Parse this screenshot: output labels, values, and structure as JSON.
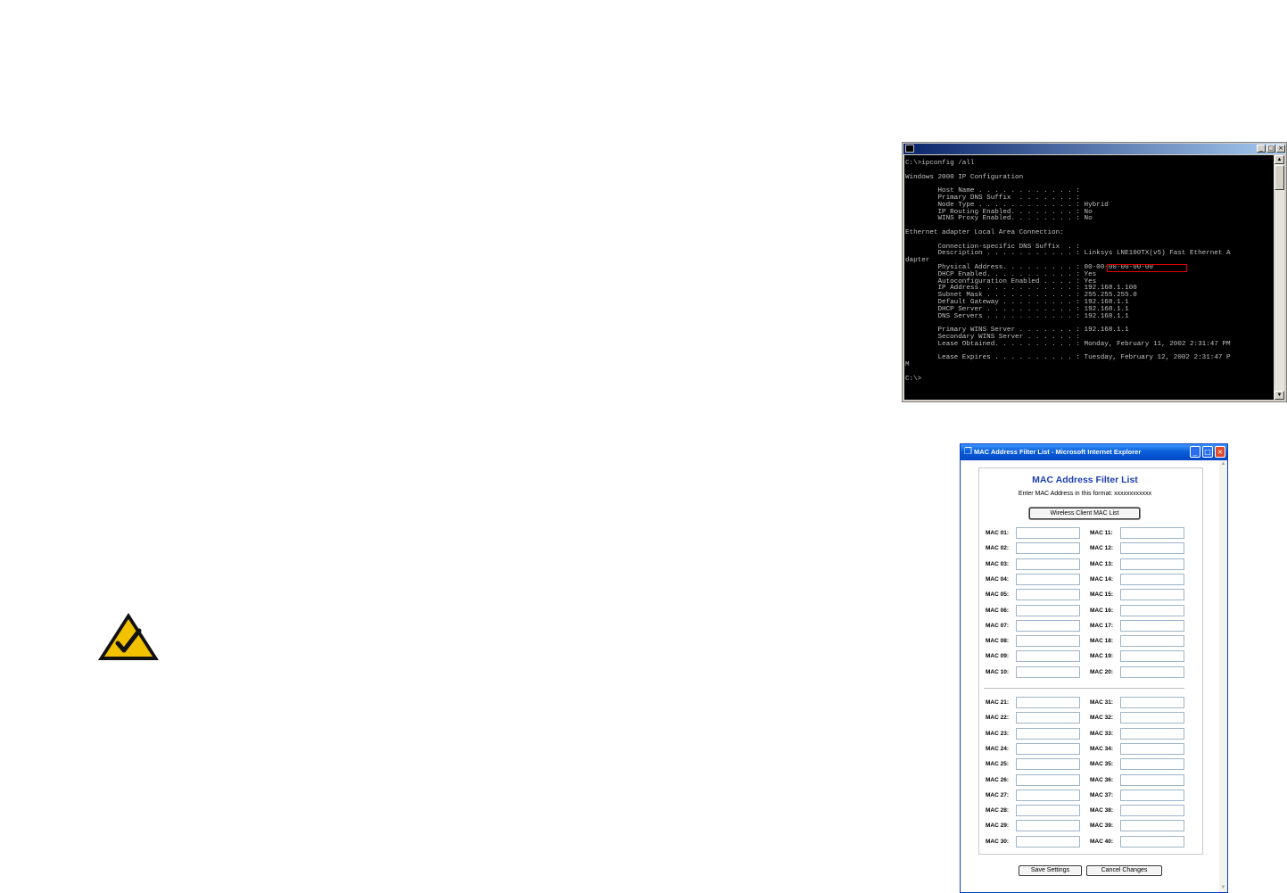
{
  "console": {
    "lines": [
      "C:\\>ipconfig /all",
      "",
      "Windows 2000 IP Configuration",
      "",
      "        Host Name . . . . . . . . . . . . :",
      "        Primary DNS Suffix  . . . . . . . :",
      "        Node Type . . . . . . . . . . . . : Hybrid",
      "        IP Routing Enabled. . . . . . . . : No",
      "        WINS Proxy Enabled. . . . . . . . : No",
      "",
      "Ethernet adapter Local Area Connection:",
      "",
      "        Connection-specific DNS Suffix  . :",
      "        Description . . . . . . . . . . . : Linksys LNE100TX(v5) Fast Ethernet A",
      "dapter",
      "        Physical Address. . . . . . . . . : 00-00-00-00-00-00",
      "        DHCP Enabled. . . . . . . . . . . : Yes",
      "        Autoconfiguration Enabled . . . . : Yes",
      "        IP Address. . . . . . . . . . . . : 192.168.1.100",
      "        Subnet Mask . . . . . . . . . . . : 255.255.255.0",
      "        Default Gateway . . . . . . . . . : 192.168.1.1",
      "        DHCP Server . . . . . . . . . . . : 192.168.1.1",
      "        DNS Servers . . . . . . . . . . . : 192.168.1.1",
      "",
      "        Primary WINS Server . . . . . . . : 192.168.1.1",
      "        Secondary WINS Server . . . . . . :",
      "        Lease Obtained. . . . . . . . . . : Monday, February 11, 2002 2:31:47 PM",
      "",
      "        Lease Expires . . . . . . . . . . : Tuesday, February 12, 2002 2:31:47 P",
      "M",
      "",
      "C:\\>"
    ],
    "highlight_color": "#e00000"
  },
  "browser": {
    "title": "MAC Address Filter List - Microsoft Internet Explorer",
    "heading": "MAC Address Filter List",
    "format_text": "Enter MAC Address in this format:  xxxxxxxxxxxx",
    "client_list_button": "Wireless Client MAC List",
    "left_group_1": [
      "MAC 01:",
      "MAC 02:",
      "MAC 03:",
      "MAC 04:",
      "MAC 05:",
      "MAC 06:",
      "MAC 07:",
      "MAC 08:",
      "MAC 09:",
      "MAC 10:"
    ],
    "right_group_1": [
      "MAC 11:",
      "MAC 12:",
      "MAC 13:",
      "MAC 14:",
      "MAC 15:",
      "MAC 16:",
      "MAC 17:",
      "MAC 18:",
      "MAC 19:",
      "MAC 20:"
    ],
    "left_group_2": [
      "MAC 21:",
      "MAC 22:",
      "MAC 23:",
      "MAC 24:",
      "MAC 25:",
      "MAC 26:",
      "MAC 27:",
      "MAC 28:",
      "MAC 29:",
      "MAC 30:"
    ],
    "right_group_2": [
      "MAC 31:",
      "MAC 32:",
      "MAC 33:",
      "MAC 34:",
      "MAC 35:",
      "MAC 36:",
      "MAC 37:",
      "MAC 38:",
      "MAC 39:",
      "MAC 40:"
    ],
    "save_button": "Save Settings",
    "cancel_button": "Cancel Changes",
    "heading_color": "#1d3fb0",
    "titlebar_color": "#0a5fd8"
  },
  "caution_icon": {
    "name": "checkmark-warning-icon",
    "fill": "#f2c200"
  }
}
